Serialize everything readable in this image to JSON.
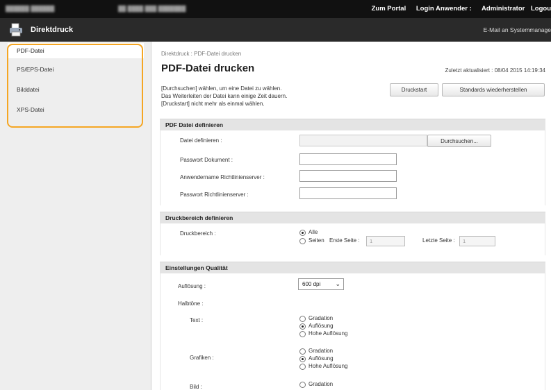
{
  "topbar": {
    "portal_link": "Zum Portal",
    "login_label": "Login Anwender :",
    "user": "Administrator",
    "logout": "Logou"
  },
  "appbar": {
    "title": "Direktdruck",
    "mail_link": "E-Mail an Systemmanage",
    "icon": "printer-icon"
  },
  "sidebar": {
    "items": [
      {
        "label": "PDF-Datei",
        "active": true
      },
      {
        "label": "PS/EPS-Datei"
      },
      {
        "label": "Bilddatei"
      },
      {
        "label": "XPS-Datei"
      }
    ],
    "highlight_color": "#f5a623"
  },
  "main": {
    "breadcrumb": "Direktdruck : PDF-Datei drucken",
    "title": "PDF-Datei drucken",
    "updated": "Zuletzt aktualisiert : 08/04 2015 14:19:34",
    "desc": [
      "[Durchsuchen] wählen, um eine Datei zu wählen.",
      "Das Weiterleiten der Datei kann einige Zeit dauern.",
      "[Druckstart] nicht mehr als einmal wählen."
    ],
    "buttons": {
      "start": "Druckstart",
      "restore": "Standards wiederherstellen"
    }
  },
  "pdf_section": {
    "title": "PDF Datei definieren",
    "file_label": "Datei definieren :",
    "browse": "Durchsuchen...",
    "pw_doc_label": "Passwort Dokument :",
    "user_label": "Anwendername Richtlinienserver :",
    "pw_server_label": "Passwort Richtlinienserver :"
  },
  "range_section": {
    "title": "Druckbereich definieren",
    "label": "Druckbereich :",
    "opt_all": "Alle",
    "opt_pages": "Seiten",
    "first_label": "Erste Seite :",
    "first_value": "1",
    "last_label": "Letzte Seite :",
    "last_value": "1"
  },
  "quality_section": {
    "title": "Einstellungen Qualität",
    "resolution_label": "Auflösung :",
    "resolution_value": "600 dpi",
    "halftone_label": "Halbtöne :",
    "text_label": "Text :",
    "graphics_label": "Grafiken :",
    "image_label": "Bild :",
    "options": [
      "Gradation",
      "Auflösung",
      "Hohe Auflösung"
    ]
  }
}
